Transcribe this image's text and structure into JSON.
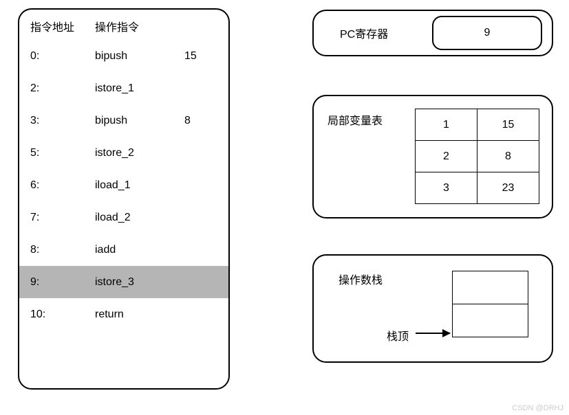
{
  "instruction_panel": {
    "header_addr": "指令地址",
    "header_op": "操作指令",
    "rows": [
      {
        "addr": "0:",
        "op": "bipush",
        "arg": "15",
        "highlight": false
      },
      {
        "addr": "2:",
        "op": "istore_1",
        "arg": "",
        "highlight": false
      },
      {
        "addr": "3:",
        "op": "bipush",
        "arg": "8",
        "highlight": false
      },
      {
        "addr": "5:",
        "op": "istore_2",
        "arg": "",
        "highlight": false
      },
      {
        "addr": "6:",
        "op": "iload_1",
        "arg": "",
        "highlight": false
      },
      {
        "addr": "7:",
        "op": "iload_2",
        "arg": "",
        "highlight": false
      },
      {
        "addr": "8:",
        "op": "iadd",
        "arg": "",
        "highlight": false
      },
      {
        "addr": "9:",
        "op": "istore_3",
        "arg": "",
        "highlight": true
      },
      {
        "addr": "10:",
        "op": "return",
        "arg": "",
        "highlight": false
      }
    ]
  },
  "pc_register": {
    "label": "PC寄存器",
    "value": "9"
  },
  "local_var_table": {
    "label": "局部变量表",
    "rows": [
      {
        "index": "1",
        "value": "15"
      },
      {
        "index": "2",
        "value": "8"
      },
      {
        "index": "3",
        "value": "23"
      }
    ]
  },
  "operand_stack": {
    "label": "操作数栈",
    "top_label": "栈顶",
    "cells": [
      "",
      ""
    ]
  },
  "watermark": "CSDN @DRHJ"
}
